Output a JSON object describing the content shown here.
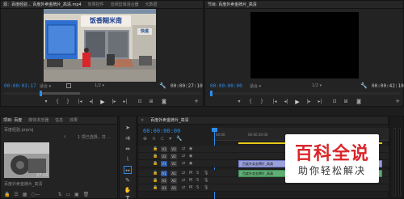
{
  "source_monitor": {
    "tab_title": "源：百度经验...",
    "tab_file": "百度外卖金牌片_高清.mp4",
    "tab_effects": "效果控件",
    "tab_audio_mixer": "音频剪辑混合器",
    "tab_metadata": "元数据",
    "timecode_current": "00:00:03:17",
    "fit_label": "适合",
    "ratio_label": "1/2",
    "timecode_duration": "00:00:27:10",
    "sign_lines": [
      "饭香糊米南",
      "快递"
    ]
  },
  "program_monitor": {
    "tab_title": "节目: 百度外卖金牌片_高清",
    "timecode_current": "00:00:00:00",
    "fit_label": "适合",
    "ratio_label": "1/2",
    "timecode_duration": "00:00:42:10"
  },
  "project_panel": {
    "tabs": [
      "项目: 百度",
      "媒体浏览器",
      "信息",
      "效果"
    ],
    "project_file": "百度经验.prproj",
    "item_count": "1 项已选择，共 ...",
    "clip_name": "百度外卖金牌片_高清",
    "clip_duration": "27:10"
  },
  "timeline": {
    "tab_title": "百度外卖金牌片_高清",
    "timecode": "00:00:00:00",
    "ruler": [
      "00:00",
      "00:00:30:00"
    ],
    "tracks": [
      {
        "label": "V3",
        "kind": "video"
      },
      {
        "label": "V2",
        "kind": "video"
      },
      {
        "label": "V1",
        "kind": "video"
      },
      {
        "label": "A1",
        "kind": "audio"
      },
      {
        "label": "A2",
        "kind": "audio"
      },
      {
        "label": "A3",
        "kind": "audio"
      }
    ],
    "clip_video_label": "百度外卖金牌片_高清",
    "clip_audio_label": "百度外卖金牌片_高清"
  },
  "watermark": {
    "title": "百科全说",
    "subtitle": "助你轻松解决"
  },
  "colors": {
    "accent_blue": "#2d8ceb",
    "clip_yellow": "#e6c91a",
    "watermark_red": "#d9262a"
  }
}
